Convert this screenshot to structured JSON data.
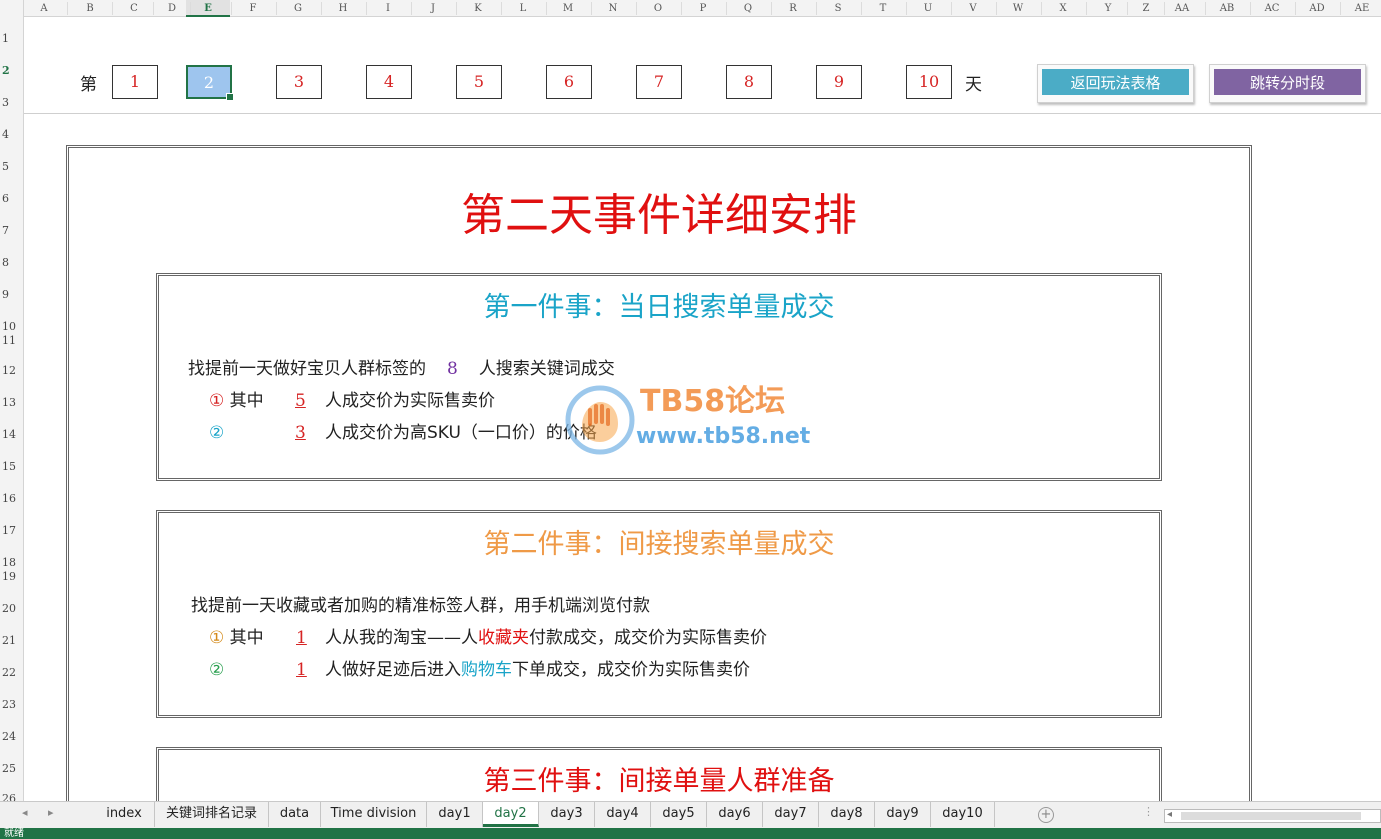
{
  "columns": [
    "A",
    "B",
    "C",
    "D",
    "E",
    "F",
    "G",
    "H",
    "I",
    "J",
    "K",
    "L",
    "M",
    "N",
    "O",
    "P",
    "Q",
    "R",
    "S",
    "T",
    "U",
    "V",
    "W",
    "X",
    "Y",
    "Z",
    "AA",
    "AB",
    "AC",
    "AD",
    "AE"
  ],
  "rows": [
    "1",
    "2",
    "3",
    "4",
    "5",
    "6",
    "7",
    "8",
    "9",
    "10",
    "11",
    "12",
    "13",
    "14",
    "15",
    "16",
    "17",
    "18",
    "19",
    "20",
    "21",
    "22",
    "23",
    "24",
    "25",
    "26"
  ],
  "day_nav": {
    "prefix": "第",
    "suffix": "天",
    "days": [
      "1",
      "2",
      "3",
      "4",
      "5",
      "6",
      "7",
      "8",
      "9",
      "10"
    ],
    "active": "2"
  },
  "buttons": {
    "back": {
      "label": "返回玩法表格",
      "color": "#4bacc6"
    },
    "jump": {
      "label": "跳转分时段",
      "color": "#8064a2"
    }
  },
  "main_title": "第二天事件详细安排",
  "event1": {
    "title": "第一件事：当日搜索单量成交",
    "line1_a": "找提前一天做好宝贝人群标签的",
    "line1_num": "8",
    "line1_b": "人搜索关键词成交",
    "item1_mark": "①",
    "item1_pre": "其中",
    "item1_num": "5",
    "item1_text": "人成交价为实际售卖价",
    "item2_mark": "②",
    "item2_num": "3",
    "item2_text": "人成交价为高SKU（一口价）的价格"
  },
  "event2": {
    "title": "第二件事：间接搜索单量成交",
    "line1": "找提前一天收藏或者加购的精准标签人群，用手机端浏览付款",
    "item1_mark": "①",
    "item1_pre": "其中",
    "item1_num": "1",
    "item1_text_a": "人从我的淘宝——人",
    "item1_highlight": "收藏夹",
    "item1_text_b": "付款成交，成交价为实际售卖价",
    "item2_mark": "②",
    "item2_num": "1",
    "item2_text_a": "人做好足迹后进入",
    "item2_highlight": "购物车",
    "item2_text_b": "下单成交，成交价为实际售卖价"
  },
  "event3": {
    "title": "第三件事：间接单量人群准备"
  },
  "watermark": {
    "name": "TB58论坛",
    "url": "www.tb58.net"
  },
  "sheet_tabs": [
    "index",
    "关键词排名记录",
    "data",
    "Time division",
    "day1",
    "day2",
    "day3",
    "day4",
    "day5",
    "day6",
    "day7",
    "day8",
    "day9",
    "day10"
  ],
  "active_tab": "day2",
  "status": "就绪"
}
